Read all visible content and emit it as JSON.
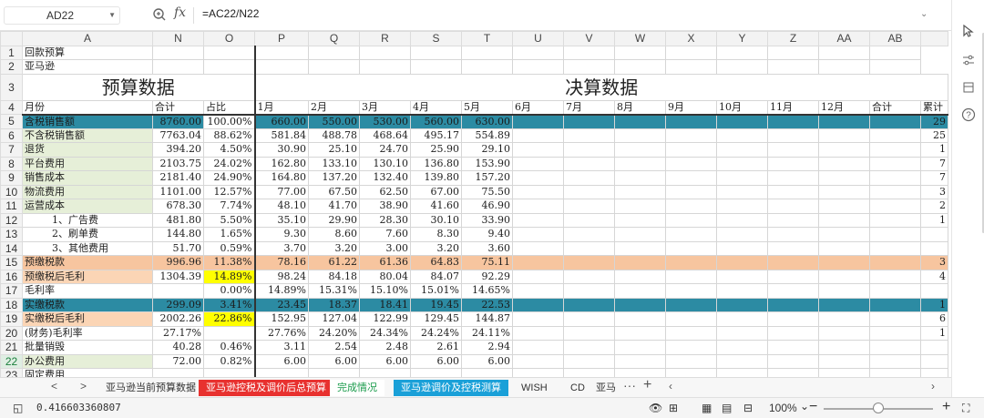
{
  "formula_bar": {
    "cell_ref": "AD22",
    "fx_label": "fx",
    "formula": "=AC22/N22"
  },
  "columns": [
    "A",
    "N",
    "O",
    "P",
    "Q",
    "R",
    "S",
    "T",
    "U",
    "V",
    "W",
    "X",
    "Y",
    "Z",
    "AA",
    "AB"
  ],
  "grid": {
    "rows": [
      {
        "n": "1",
        "cells": [
          "回款预算",
          "",
          "",
          "",
          "",
          "",
          "",
          "",
          "",
          "",
          "",
          "",
          "",
          "",
          "",
          ""
        ]
      },
      {
        "n": "2",
        "cells": [
          "亚马逊",
          "",
          "",
          "",
          "",
          "",
          "",
          "",
          "",
          "",
          "",
          "",
          "",
          "",
          "",
          ""
        ]
      },
      {
        "n": "3",
        "budget_title": "预算数据",
        "final_title": "决算数据"
      },
      {
        "n": "4",
        "cells": [
          "月份",
          "合计",
          "占比",
          "1月",
          "2月",
          "3月",
          "4月",
          "5月",
          "6月",
          "7月",
          "8月",
          "9月",
          "10月",
          "11月",
          "12月",
          "合计",
          "累计"
        ]
      },
      {
        "n": "5",
        "cells": [
          "含税销售额",
          "8760.00",
          "100.00%",
          "660.00",
          "550.00",
          "530.00",
          "560.00",
          "630.00",
          "",
          "",
          "",
          "",
          "",
          "",
          "",
          "",
          "29"
        ]
      },
      {
        "n": "6",
        "cells": [
          "不含税销售额",
          "7763.04",
          "88.62%",
          "581.84",
          "488.78",
          "468.64",
          "495.17",
          "554.89",
          "",
          "",
          "",
          "",
          "",
          "",
          "",
          "",
          "25"
        ]
      },
      {
        "n": "7",
        "cells": [
          "退货",
          "394.20",
          "4.50%",
          "30.90",
          "25.10",
          "24.70",
          "25.90",
          "29.10",
          "",
          "",
          "",
          "",
          "",
          "",
          "",
          "",
          "1"
        ]
      },
      {
        "n": "8",
        "cells": [
          "平台费用",
          "2103.75",
          "24.02%",
          "162.80",
          "133.10",
          "130.10",
          "136.80",
          "153.90",
          "",
          "",
          "",
          "",
          "",
          "",
          "",
          "",
          "7"
        ]
      },
      {
        "n": "9",
        "cells": [
          "销售成本",
          "2181.40",
          "24.90%",
          "164.80",
          "137.20",
          "132.40",
          "139.80",
          "157.20",
          "",
          "",
          "",
          "",
          "",
          "",
          "",
          "",
          "7"
        ]
      },
      {
        "n": "10",
        "cells": [
          "物流费用",
          "1101.00",
          "12.57%",
          "77.00",
          "67.50",
          "62.50",
          "67.00",
          "75.50",
          "",
          "",
          "",
          "",
          "",
          "",
          "",
          "",
          "3"
        ]
      },
      {
        "n": "11",
        "cells": [
          "运营成本",
          "678.30",
          "7.74%",
          "48.10",
          "41.70",
          "38.90",
          "41.60",
          "46.90",
          "",
          "",
          "",
          "",
          "",
          "",
          "",
          "",
          "2"
        ]
      },
      {
        "n": "12",
        "cells": [
          "1、广告费",
          "481.80",
          "5.50%",
          "35.10",
          "29.90",
          "28.30",
          "30.10",
          "33.90",
          "",
          "",
          "",
          "",
          "",
          "",
          "",
          "",
          "1"
        ]
      },
      {
        "n": "13",
        "cells": [
          "2、刷单费",
          "144.80",
          "1.65%",
          "9.30",
          "8.60",
          "7.60",
          "8.30",
          "9.40",
          "",
          "",
          "",
          "",
          "",
          "",
          "",
          "",
          ""
        ]
      },
      {
        "n": "14",
        "cells": [
          "3、其他费用",
          "51.70",
          "0.59%",
          "3.70",
          "3.20",
          "3.00",
          "3.20",
          "3.60",
          "",
          "",
          "",
          "",
          "",
          "",
          "",
          "",
          ""
        ]
      },
      {
        "n": "15",
        "cells": [
          "预缴税款",
          "996.96",
          "11.38%",
          "78.16",
          "61.22",
          "61.36",
          "64.83",
          "75.11",
          "",
          "",
          "",
          "",
          "",
          "",
          "",
          "",
          "3"
        ]
      },
      {
        "n": "16",
        "cells": [
          "预缴税后毛利",
          "1304.39",
          "14.89%",
          "98.24",
          "84.18",
          "80.04",
          "84.07",
          "92.29",
          "",
          "",
          "",
          "",
          "",
          "",
          "",
          "",
          "4"
        ]
      },
      {
        "n": "17",
        "cells": [
          "毛利率",
          "",
          "0.00%",
          "14.89%",
          "15.31%",
          "15.10%",
          "15.01%",
          "14.65%",
          "",
          "",
          "",
          "",
          "",
          "",
          "",
          "",
          ""
        ]
      },
      {
        "n": "18",
        "cells": [
          "实缴税款",
          "299.09",
          "3.41%",
          "23.45",
          "18.37",
          "18.41",
          "19.45",
          "22.53",
          "",
          "",
          "",
          "",
          "",
          "",
          "",
          "",
          "1"
        ]
      },
      {
        "n": "19",
        "cells": [
          "实缴税后毛利",
          "2002.26",
          "22.86%",
          "152.95",
          "127.04",
          "122.99",
          "129.45",
          "144.87",
          "",
          "",
          "",
          "",
          "",
          "",
          "",
          "",
          "6"
        ]
      },
      {
        "n": "20",
        "cells": [
          "(财务)毛利率",
          "27.17%",
          "",
          "27.76%",
          "24.20%",
          "24.34%",
          "24.24%",
          "24.11%",
          "",
          "",
          "",
          "",
          "",
          "",
          "",
          "",
          "1"
        ]
      },
      {
        "n": "21",
        "cells": [
          "批量销毁",
          "40.28",
          "0.46%",
          "3.11",
          "2.54",
          "2.48",
          "2.61",
          "2.94",
          "",
          "",
          "",
          "",
          "",
          "",
          "",
          "",
          ""
        ]
      },
      {
        "n": "22",
        "cells": [
          "办公费用",
          "72.00",
          "0.82%",
          "6.00",
          "6.00",
          "6.00",
          "6.00",
          "6.00",
          "",
          "",
          "",
          "",
          "",
          "",
          "",
          "",
          ""
        ]
      },
      {
        "n": "23",
        "cells": [
          "固定费用",
          "",
          "",
          "",
          "",
          "",
          "",
          "",
          "",
          "",
          "",
          "",
          "",
          "",
          "",
          "",
          ""
        ]
      }
    ]
  },
  "sheet_tabs": [
    {
      "label": "亚马逊当前预算数据",
      "bg": "#f7f7f7",
      "fg": "#333"
    },
    {
      "label": "亚马逊控税及调价后总预算",
      "bg": "#e8312f",
      "fg": "#ffffff"
    },
    {
      "label": "完成情况",
      "bg": "#ffffff",
      "fg": "#1a9b4b"
    },
    {
      "label": "亚马逊调价及控税测算",
      "bg": "#1aa0d8",
      "fg": "#ffffff"
    },
    {
      "label": "WISH",
      "bg": "#f7f7f7",
      "fg": "#333"
    },
    {
      "label": "CD",
      "bg": "#f7f7f7",
      "fg": "#333"
    },
    {
      "label": "亚马",
      "bg": "#f7f7f7",
      "fg": "#333"
    }
  ],
  "status": {
    "value": "0.416603360807",
    "zoom": "100%",
    "zoom_level_pct": 50
  },
  "colors": {
    "teal": "#2c8ba3",
    "light_green": "#e6efd8",
    "orange": "#f7c59f",
    "yellow": "#ffff00",
    "selected_row": "#1a7f3c"
  }
}
